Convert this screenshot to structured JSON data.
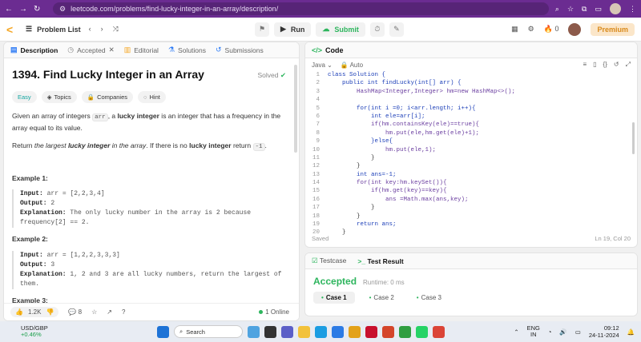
{
  "browser": {
    "url": "leetcode.com/problems/find-lucky-integer-in-an-array/description/"
  },
  "topbar": {
    "problem_list": "Problem List",
    "run": "Run",
    "submit": "Submit",
    "notif_count": "0",
    "premium": "Premium"
  },
  "left_tabs": {
    "description": "Description",
    "accepted": "Accepted",
    "editorial": "Editorial",
    "solutions": "Solutions",
    "submissions": "Submissions"
  },
  "problem": {
    "title": "1394. Find Lucky Integer in an Array",
    "status": "Solved",
    "difficulty": "Easy",
    "topics": "Topics",
    "companies": "Companies",
    "hint": "Hint",
    "p1_a": "Given an array of integers ",
    "p1_code": "arr",
    "p1_b": ", a ",
    "p1_bold": "lucky integer",
    "p1_c": " is an integer that has a frequency in the array equal to its value.",
    "p2_a": "Return ",
    "p2_i1": "the largest ",
    "p2_bi": "lucky integer",
    "p2_i2": " in the array",
    "p2_b": ". If there is no ",
    "p2_bold": "lucky integer",
    "p2_c": " return ",
    "p2_code": "-1",
    "p2_d": ".",
    "examples": [
      {
        "title": "Example 1:",
        "input": "arr = [2,2,3,4]",
        "output": "2",
        "explanation": "The only lucky number in the array is 2 because frequency[2] == 2."
      },
      {
        "title": "Example 2:",
        "input": "arr = [1,2,2,3,3,3]",
        "output": "3",
        "explanation": "1, 2 and 3 are all lucky numbers, return the largest of them."
      },
      {
        "title": "Example 3:"
      }
    ],
    "labels": {
      "input": "Input:",
      "output": "Output:",
      "explanation": "Explanation:"
    }
  },
  "left_footer": {
    "likes": "1.2K",
    "comments": "8",
    "online": "1 Online"
  },
  "code_panel": {
    "title": "Code",
    "language": "Java",
    "mode": "Auto",
    "saved": "Saved",
    "cursor": "Ln 19, Col 20",
    "lines": [
      "class Solution {",
      "    public int findLucky(int[] arr) {",
      "        HashMap<Integer,Integer> hm=new HashMap<>();",
      "",
      "        for(int i =0; i<arr.length; i++){",
      "            int ele=arr[i];",
      "            if(hm.containsKey(ele)==true){",
      "                hm.put(ele,hm.get(ele)+1);",
      "            }else{",
      "                hm.put(ele,1);",
      "            }",
      "        }",
      "        int ans=-1;",
      "        for(int key:hm.keySet()){",
      "            if(hm.get(key)==key){",
      "                ans =Math.max(ans,key);",
      "            }",
      "        }",
      "        return ans;",
      "    }"
    ]
  },
  "test_panel": {
    "testcase": "Testcase",
    "result": "Test Result",
    "verdict": "Accepted",
    "runtime": "Runtime: 0 ms",
    "cases": [
      "Case 1",
      "Case 2",
      "Case 3"
    ]
  },
  "taskbar": {
    "stock_name": "USD/GBP",
    "stock_change": "+0.46%",
    "search": "Search",
    "lang1": "ENG",
    "lang2": "IN",
    "time": "09:12",
    "date": "24-11-2024"
  }
}
